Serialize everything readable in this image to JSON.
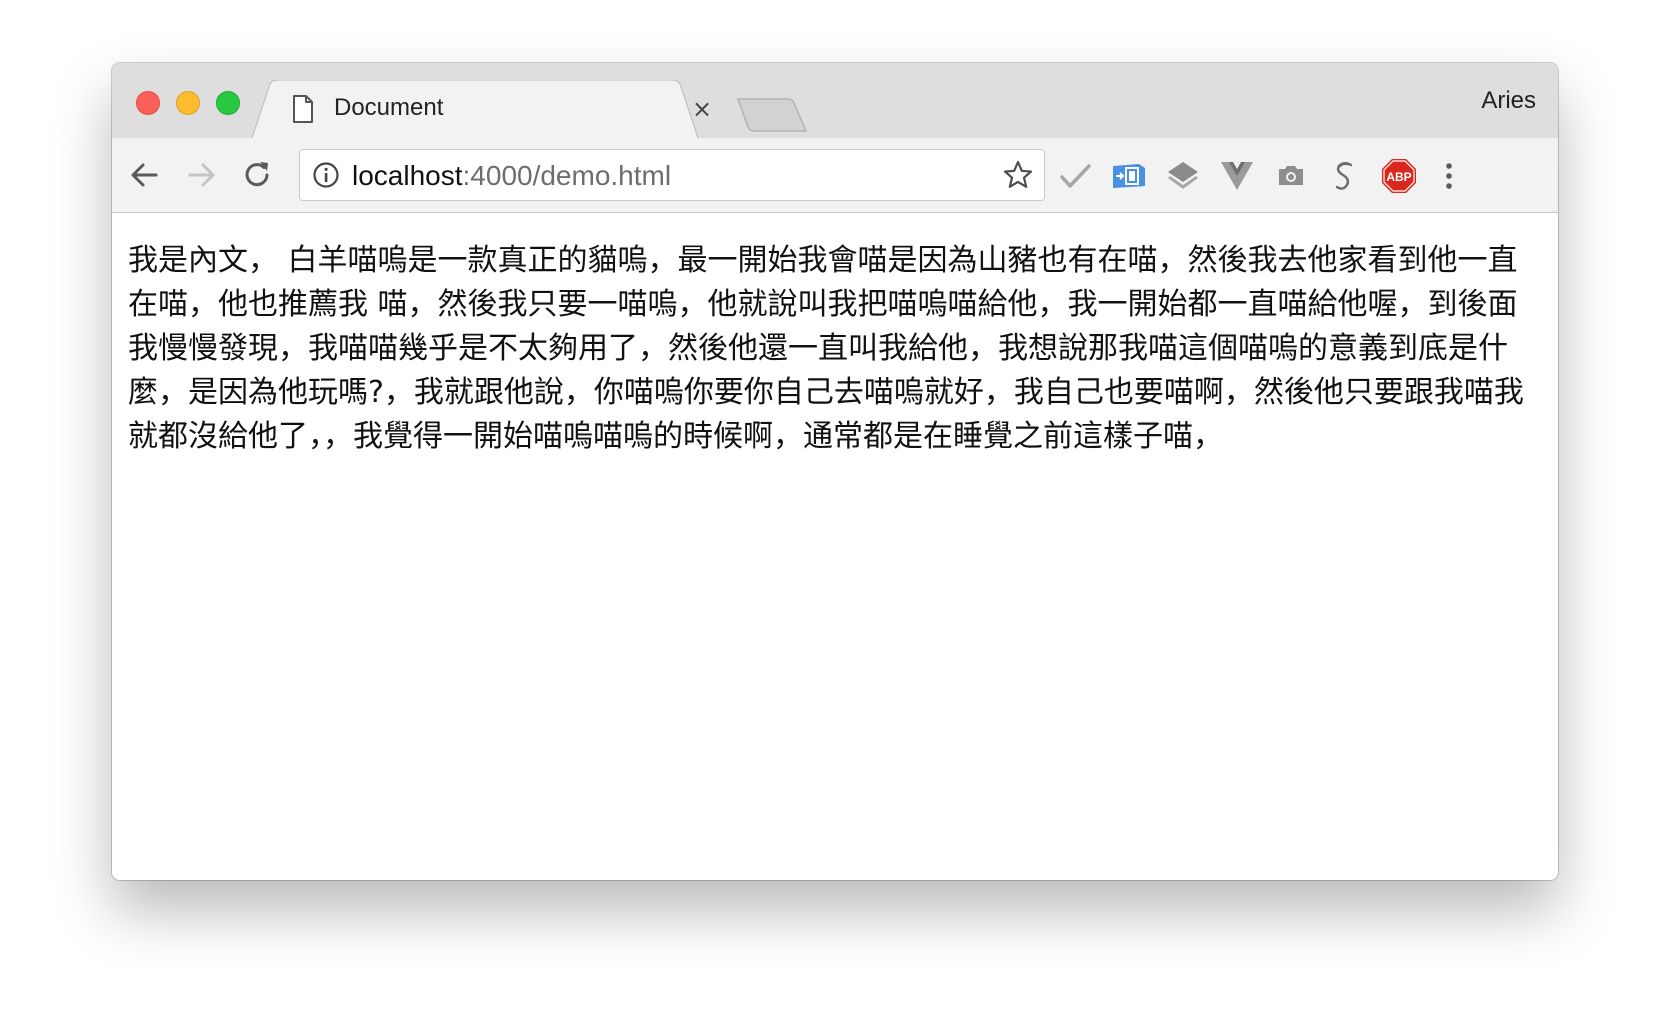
{
  "window": {
    "profile_name": "Aries"
  },
  "tab": {
    "title": "Document",
    "close_glyph": "×"
  },
  "toolbar": {
    "url_host": "localhost",
    "url_rest": ":4000/demo.html",
    "extensions": [
      {
        "name": "check-extension-icon",
        "color": "#9e9e9e"
      },
      {
        "name": "translate-extension-icon",
        "color": "#4a90e2"
      },
      {
        "name": "layers-extension-icon",
        "color": "#8a8a8a"
      },
      {
        "name": "vue-devtools-icon",
        "color": "#8a8a8a"
      },
      {
        "name": "camera-extension-icon",
        "color": "#8a8a8a"
      },
      {
        "name": "s-extension-icon",
        "color": "#6a6a6a"
      },
      {
        "name": "adblock-plus-icon",
        "color": "#e0281b",
        "label": "ABP"
      }
    ]
  },
  "content": {
    "paragraph": "我是內文， 白羊喵嗚是一款真正的貓嗚，最一開始我會喵是因為山豬也有在喵，然後我去他家看到他一直在喵，他也推薦我 喵，然後我只要一喵嗚，他就說叫我把喵嗚喵給他，我一開始都一直喵給他喔，到後面我慢慢發現，我喵喵幾乎是不太夠用了，然後他還一直叫我給他，我想說那我喵這個喵嗚的意義到底是什麼，是因為他玩嗎?，我就跟他說，你喵嗚你要你自己去喵嗚就好，我自己也要喵啊，然後他只要跟我喵我就都沒給他了，，我覺得一開始喵嗚喵嗚的時候啊，通常都是在睡覺之前這樣子喵，"
  }
}
